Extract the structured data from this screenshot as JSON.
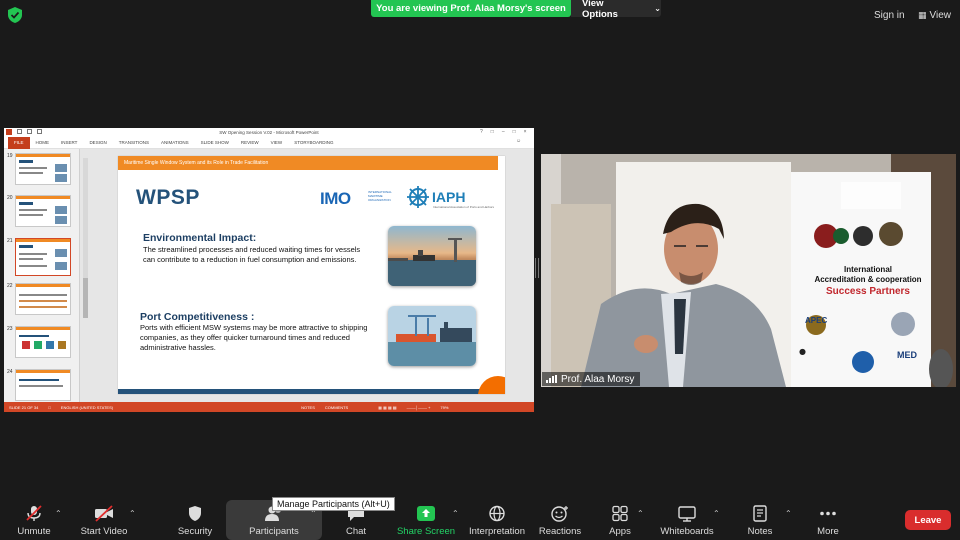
{
  "top_bar": {
    "banner": "You are viewing Prof. Alaa Morsy's screen",
    "view_options": "View Options",
    "sign_in": "Sign in",
    "view": "View"
  },
  "ppt": {
    "window_title": "SW Opening Session V.02 - Microsoft PowerPoint",
    "ribbon_tabs": [
      "FILE",
      "HOME",
      "INSERT",
      "DESIGN",
      "TRANSITIONS",
      "ANIMATIONS",
      "SLIDE SHOW",
      "REVIEW",
      "VIEW",
      "STORYBOARDING"
    ],
    "thumb_numbers": [
      "19",
      "20",
      "21",
      "22",
      "23",
      "24"
    ],
    "status": {
      "slide": "SLIDE 21 OF 34",
      "language": "ENGLISH (UNITED STATES)",
      "notes": "NOTES",
      "comments": "COMMENTS",
      "zoom": "79%"
    }
  },
  "slide": {
    "header": "Maritime Single Window System and its Role in Trade Facilitation",
    "wpsp": "WPSP",
    "imo": "IMO",
    "imo_sub": "INTERNATIONAL MARITIME ORGANIZATION",
    "iaph": "IAPH",
    "iaph_sub": "International Association of Ports and Harbors",
    "env_title": "Environmental Impact:",
    "env_text": "The streamlined processes and reduced waiting times for vessels can contribute to a reduction in fuel consumption and emissions.",
    "port_title": "Port Competitiveness :",
    "port_text": "Ports with efficient MSW systems may be more attractive to shipping companies, as they offer quicker turnaround times and reduced administrative hassles."
  },
  "camera": {
    "name": "Prof. Alaa Morsy",
    "banner_text_1": "International",
    "banner_text_2": "Accreditation & cooperation",
    "banner_text_3": "Success Partners",
    "logo_apec": "APEC",
    "logo_med": "MED"
  },
  "tooltip": "Manage Participants (Alt+U)",
  "toolbar": {
    "unmute": "Unmute",
    "start_video": "Start Video",
    "security": "Security",
    "participants": "Participants",
    "chat": "Chat",
    "share_screen": "Share Screen",
    "interpretation": "Interpretation",
    "reactions": "Reactions",
    "apps": "Apps",
    "whiteboards": "Whiteboards",
    "notes": "Notes",
    "more": "More",
    "leave": "Leave"
  },
  "colors": {
    "share_green": "#23c552",
    "leave_red": "#d92d2d",
    "ppt_orange": "#d24726",
    "slide_orange": "#f08a24",
    "slide_blue": "#24527a"
  }
}
